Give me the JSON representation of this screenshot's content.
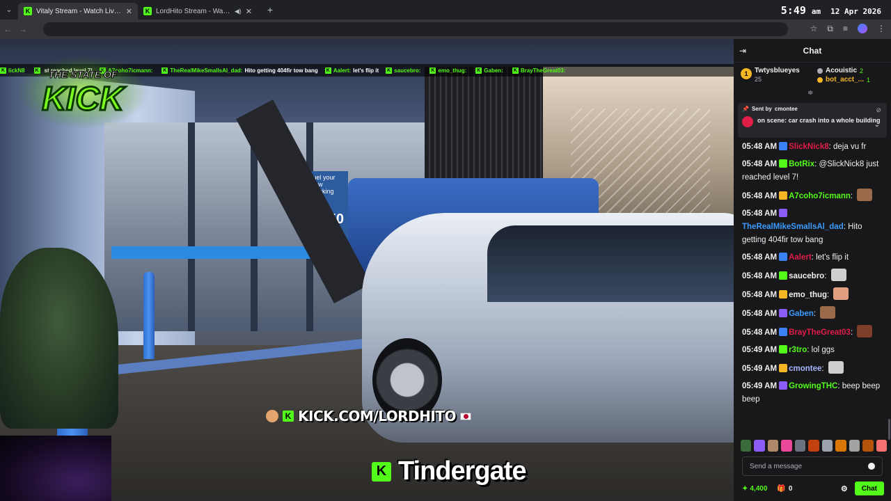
{
  "browser": {
    "tabs": [
      {
        "title": "Vitaly Stream - Watch Live on K",
        "active": true
      },
      {
        "title": "LordHito Stream - Watch L",
        "active": false
      }
    ],
    "clock": {
      "time": "5:49",
      "ampm": "am",
      "date": "12 Apr 2026"
    }
  },
  "stream": {
    "logo_line1": "THE STATE OF",
    "logo_line2": "KICK",
    "ticker": [
      {
        "user": "lickN8",
        "msg": ""
      },
      {
        "user": "",
        "msg": "st reached level 7!"
      },
      {
        "user": "A7coho7icmann:",
        "msg": ""
      },
      {
        "user": "TheRealMikeSmallsAl_dad:",
        "msg": "Hito getting 404fir tow bang"
      },
      {
        "user": "Aalert:",
        "msg": "let's flip it"
      },
      {
        "user": "saucebro:",
        "msg": ""
      },
      {
        "user": "emo_thug:",
        "msg": ""
      },
      {
        "user": "Gaben:",
        "msg": ""
      },
      {
        "user": "BrayTheGreat03:",
        "msg": ""
      }
    ],
    "kick_url": "KICK.COM/LORDHITO",
    "caption": "Tindergate",
    "ad_text": "Fuel your grow checking bonu",
    "ad_amount": "$1,50"
  },
  "chat": {
    "title": "Chat",
    "leaderboard": {
      "first": {
        "rank": "1",
        "name": "Twtysblueyes",
        "count": "25"
      },
      "second": {
        "name": "Acouistic",
        "count": "2"
      },
      "third": {
        "name": "bot_acct_...",
        "count": "1"
      }
    },
    "pinned": {
      "sent_by_label": "Sent by",
      "sent_by_user": "cmontee",
      "text": "on scene: car crash into a whole building"
    },
    "messages": [
      {
        "time": "05:48 AM",
        "user": "SlickNick8",
        "color": "#e11d48",
        "text": "deja vu fr"
      },
      {
        "time": "05:48 AM",
        "user": "BotRix",
        "color": "#53fc18",
        "text": "@SlickNick8 just reached level 7!"
      },
      {
        "time": "05:48 AM",
        "user": "A7coho7icmann",
        "color": "#53fc18",
        "text": ""
      },
      {
        "time": "05:48 AM",
        "user": "TheRealMikeSmallsAl_dad",
        "color": "#3b9bff",
        "text": "Hito getting 404fir tow bang"
      },
      {
        "time": "05:48 AM",
        "user": "Aalert",
        "color": "#e11d48",
        "text": "let's flip it"
      },
      {
        "time": "05:48 AM",
        "user": "saucebro",
        "color": "#efeff1",
        "text": ""
      },
      {
        "time": "05:48 AM",
        "user": "emo_thug",
        "color": "#efeff1",
        "text": ""
      },
      {
        "time": "05:48 AM",
        "user": "Gaben",
        "color": "#3b9bff",
        "text": ""
      },
      {
        "time": "05:48 AM",
        "user": "BrayTheGreat03",
        "color": "#e11d48",
        "text": ""
      },
      {
        "time": "05:49 AM",
        "user": "r3tro",
        "color": "#53fc18",
        "text": "lol ggs"
      },
      {
        "time": "05:49 AM",
        "user": "cmontee",
        "color": "#a5b4fc",
        "text": ""
      },
      {
        "time": "05:49 AM",
        "user": "GrowingTHC",
        "color": "#53fc18",
        "text": "beep beep beep"
      }
    ],
    "input_placeholder": "Send a message",
    "points": "4,400",
    "gifts": "0",
    "send_label": "Chat"
  },
  "colors": {
    "kick_green": "#53fc18",
    "chat_bg": "#18181b"
  }
}
